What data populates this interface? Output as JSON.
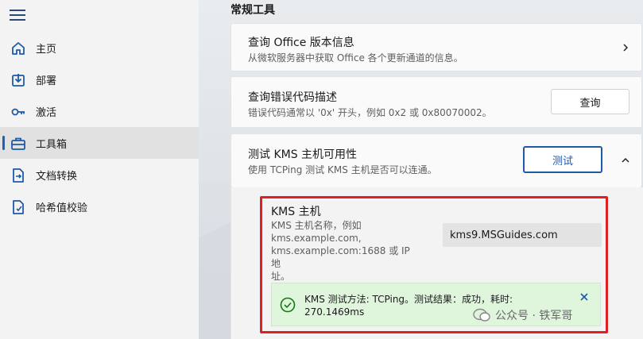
{
  "sidebar": {
    "items": [
      {
        "label": "主页",
        "icon": "home-icon"
      },
      {
        "label": "部署",
        "icon": "download-icon"
      },
      {
        "label": "激活",
        "icon": "key-icon"
      },
      {
        "label": "工具箱",
        "icon": "toolbox-icon"
      },
      {
        "label": "文档转换",
        "icon": "document-convert-icon"
      },
      {
        "label": "哈希值校验",
        "icon": "hash-check-icon"
      }
    ],
    "active_index": 3
  },
  "main": {
    "section_title": "常规工具",
    "cards": [
      {
        "title": "查询 Office 版本信息",
        "desc": "从微软服务器中获取 Office 各个更新通道的信息。"
      },
      {
        "title": "查询错误代码描述",
        "desc": "错误代码通常以 '0x' 开头，例如 0x2 或 0x80070002。",
        "button": "查询"
      },
      {
        "title": "测试 KMS 主机可用性",
        "desc": "使用 TCPing 测试 KMS 主机是否可以连通。",
        "button": "测试"
      }
    ],
    "kms": {
      "title": "KMS 主机",
      "desc_lines": [
        "KMS 主机名称，例如",
        "kms.example.com,",
        "kms.example.com:1688 或 IP 地",
        "址。"
      ],
      "input_value": "kms9.MSGuides.com",
      "result_line1": "KMS 测试方法: TCPing。测试结果：成功，耗时:",
      "result_line2": "270.1469ms"
    }
  },
  "watermark": {
    "text": "公众号 · 铁军哥"
  },
  "colors": {
    "accent": "#1e5aa8",
    "highlight_box": "#e02020",
    "success_bg": "#dff6dd",
    "success_icon": "#107c10"
  }
}
